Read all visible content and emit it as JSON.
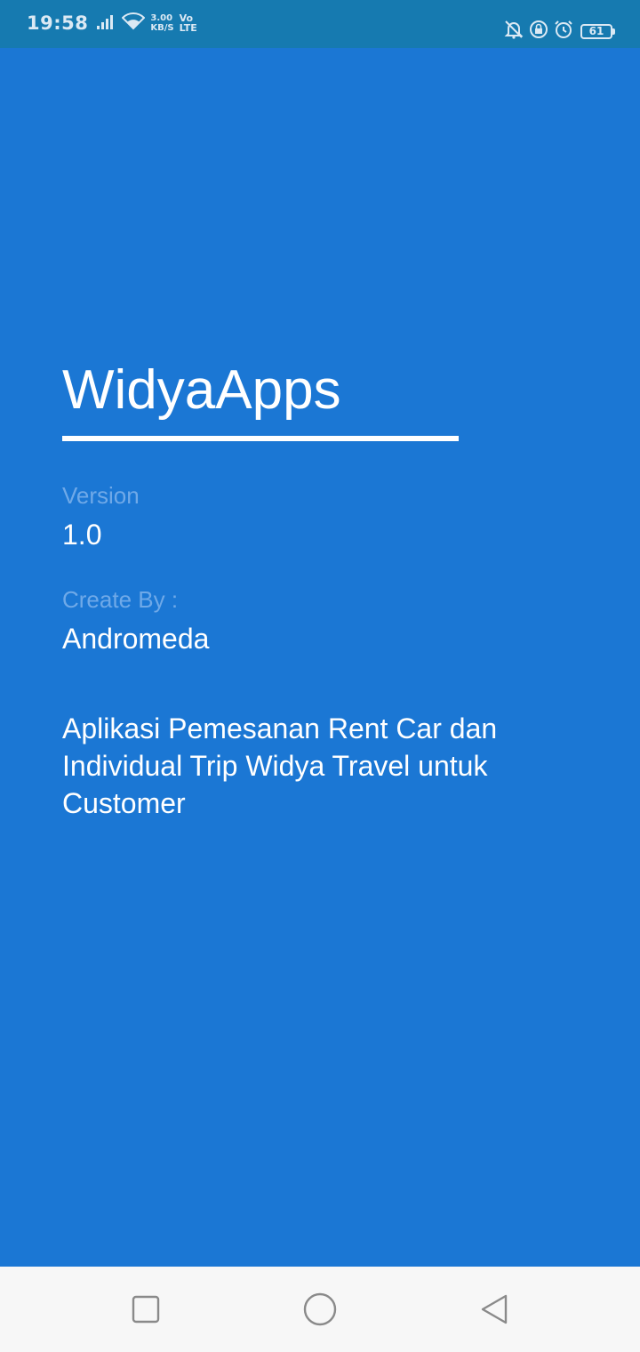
{
  "status_bar": {
    "time": "19:58",
    "speed_value": "3.00",
    "speed_unit": "KB/S",
    "volte_top": "Vo",
    "volte_bottom": "LTE",
    "battery_level": "61"
  },
  "about": {
    "app_name": "WidyaApps",
    "version_label": "Version",
    "version_value": "1.0",
    "author_label": "Create By :",
    "author_value": "Andromeda",
    "description": "Aplikasi Pemesanan Rent Car dan Individual Trip Widya Travel untuk Customer"
  },
  "colors": {
    "background": "#1b77d4",
    "status_bar": "#167ab0",
    "label": "#6fa9e8",
    "text": "#ffffff",
    "nav_bar": "#f7f7f7"
  },
  "navigation": {
    "buttons": [
      "recents-icon",
      "home-icon",
      "back-icon"
    ]
  }
}
